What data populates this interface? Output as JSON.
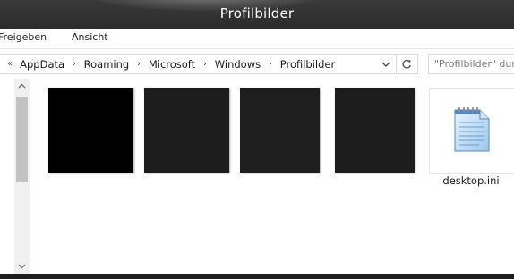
{
  "window": {
    "title": "Profilbilder"
  },
  "ribbon": {
    "tabs": [
      "Freigeben",
      "Ansicht"
    ]
  },
  "address": {
    "crumbs": [
      "AppData",
      "Roaming",
      "Microsoft",
      "Windows",
      "Profilbilder"
    ],
    "overflow_symbol": "«",
    "separator_symbol": "›"
  },
  "search": {
    "placeholder": "\"Profilbilder\" durchsuchen"
  },
  "files": {
    "thumbnail_colors": [
      "#000000",
      "#1d1d1d",
      "#1e1e1e",
      "#1d1d1d"
    ],
    "desktop_ini": {
      "name": "desktop.ini",
      "icon": "notepad-file-icon"
    }
  },
  "colors": {
    "titlebar": "#2b2b2b",
    "scrollbar_thumb": "#c2c2c2"
  }
}
